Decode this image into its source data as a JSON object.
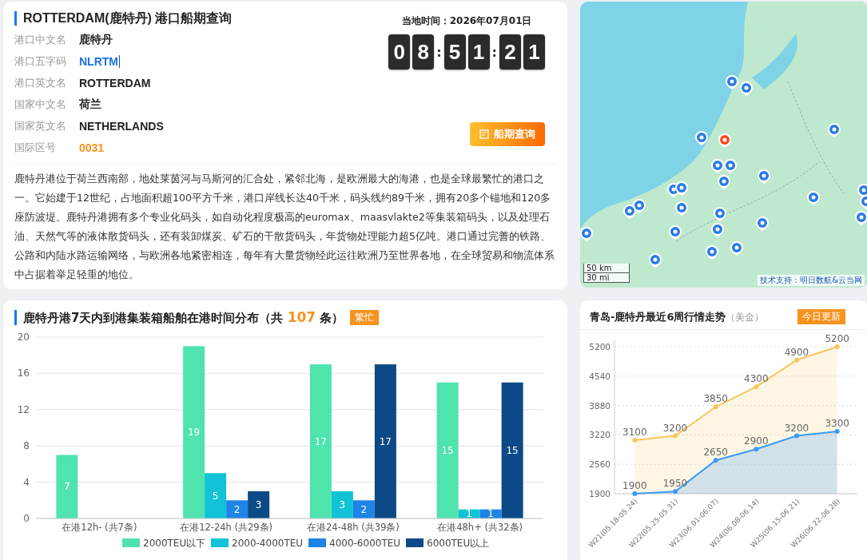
{
  "port_card": {
    "title": "ROTTERDAM(鹿特丹) 港口船期查询",
    "fields": [
      {
        "label": "港口中文名",
        "value": "鹿特丹",
        "kind": "plain"
      },
      {
        "label": "港口五字码",
        "value": "NLRTM",
        "kind": "link"
      },
      {
        "label": "港口英文名",
        "value": "ROTTERDAM",
        "kind": "plain"
      },
      {
        "label": "国家中文名",
        "value": "荷兰",
        "kind": "plain"
      },
      {
        "label": "国家英文名",
        "value": "NETHERLANDS",
        "kind": "plain"
      },
      {
        "label": "国际区号",
        "value": "0031",
        "kind": "accent"
      }
    ],
    "local_time": "当地时间：2026年07月01日",
    "clock": [
      {
        "kind": "digit",
        "text": "0"
      },
      {
        "kind": "digit",
        "text": "8"
      },
      {
        "kind": "sep",
        "text": ":"
      },
      {
        "kind": "digit",
        "text": "5"
      },
      {
        "kind": "digit",
        "text": "1"
      },
      {
        "kind": "sep",
        "text": ":"
      },
      {
        "kind": "digit",
        "text": "2"
      },
      {
        "kind": "digit",
        "text": "1"
      }
    ],
    "button": "船期查询",
    "description": "鹿特丹港位于荷兰西南部，地处莱茵河与马斯河的汇合处，紧邻北海，是欧洲最大的海港，也是全球最繁忙的港口之一。它始建于12世纪，占地面积超100平方千米，港口岸线长达40千米，码头线约89千米，拥有20多个锚地和120多座防波堤。鹿特丹港拥有多个专业化码头，如自动化程度极高的euromax、maasvlakte2等集装箱码头，以及处理石油、天然气等的液体散货码头，还有装卸煤炭、矿石的干散货码头，年货物处理能力超5亿吨。港口通过完善的铁路、公路和内陆水路运输网络，与欧洲各地紧密相连，每年有大量货物经此运往欧洲乃至世界各地，在全球贸易和物流体系中占据着举足轻重的地位。"
  },
  "map": {
    "scale": [
      "50 km",
      "30 mi"
    ],
    "attribution": "技术支持：明日数航&云当网"
  },
  "dwell_card": {
    "title_prefix": "鹿特丹港7天内到港集装箱船舶在港时间分布（共 ",
    "count": "107",
    "title_suffix": " 条）",
    "badge": "繁忙",
    "chart_data": {
      "type": "bar",
      "categories": [
        "在港12h- (共7条)",
        "在港12-24h (共29条)",
        "在港24-48h (共39条)",
        "在港48h+ (共32条)"
      ],
      "series": [
        {
          "name": "2000TEU以下",
          "color": "#4fe3ad",
          "values": [
            7,
            19,
            17,
            15
          ]
        },
        {
          "name": "2000-4000TEU",
          "color": "#12c2d6",
          "values": [
            0,
            5,
            3,
            1
          ]
        },
        {
          "name": "4000-6000TEU",
          "color": "#1e84e6",
          "values": [
            0,
            2,
            2,
            1
          ]
        },
        {
          "name": "6000TEU以上",
          "color": "#0c4a87",
          "values": [
            0,
            3,
            17,
            15
          ]
        }
      ],
      "ylim": [
        0,
        20
      ],
      "yticks": [
        0,
        4,
        8,
        12,
        16,
        20
      ],
      "grid": true,
      "legend": "bottom",
      "value_labels": [
        [
          "7",
          "19",
          "17",
          "15"
        ],
        [
          null,
          "5",
          "3",
          "1"
        ],
        [
          null,
          "2",
          "2",
          "1"
        ],
        [
          null,
          "3",
          "17",
          "15"
        ]
      ]
    }
  },
  "trend_card": {
    "title": "青岛-鹿特丹最近6周行情走势",
    "unit": "（美金）",
    "badge": "今日更新",
    "chart_data": {
      "type": "area",
      "categories": [
        "W21(05.18-05.24)",
        "W22(05.25-05.31)",
        "W23(06.01-06.07)",
        "W24(06.08-06.14)",
        "W25(06.15-06.21)",
        "W26(06.22-06.28)"
      ],
      "series": [
        {
          "color": "#f9c55a",
          "values": [
            3100,
            3200,
            3850,
            4300,
            4900,
            5200
          ]
        },
        {
          "color": "#3a9bf5",
          "values": [
            1900,
            1950,
            2650,
            2900,
            3200,
            3300
          ]
        }
      ],
      "ylim": [
        1900,
        5200
      ],
      "grid": true,
      "yticks": [
        1900,
        2560,
        3220,
        3880,
        4540,
        5200
      ],
      "data_labels": true
    }
  }
}
